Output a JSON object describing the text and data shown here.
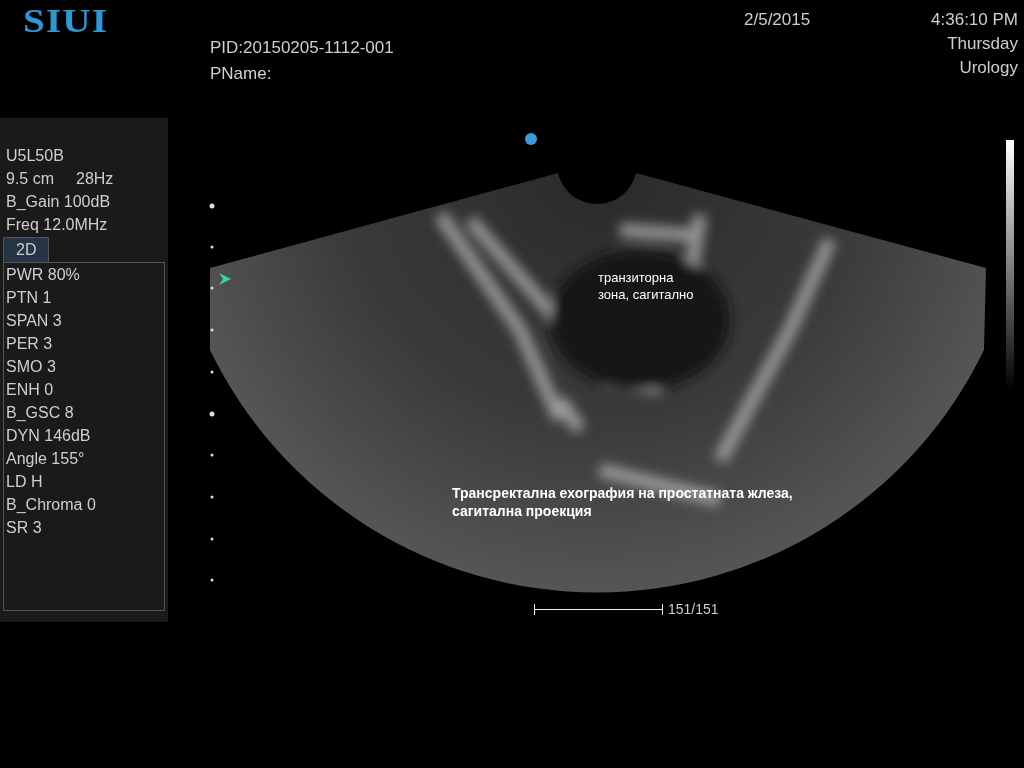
{
  "logo": "SIUI",
  "patient": {
    "pid": "PID:20150205-1112-001",
    "name": "PName:"
  },
  "date": "2/5/2015",
  "time": "4:36:10 PM",
  "weekday": "Thursday",
  "exam": "Urology",
  "probe": {
    "model": "U5L50B",
    "depth": "9.5 cm",
    "frame_rate": "28Hz",
    "gain": "B_Gain 100dB",
    "frequency": "Freq 12.0MHz"
  },
  "tabs": [
    {
      "label": "2D",
      "selected": true
    }
  ],
  "parameters": [
    "PWR 80%",
    "PTN 1",
    "SPAN 3",
    "PER 3",
    "SMO 3",
    "ENH 0",
    "B_GSC 8",
    "DYN 146dB",
    "Angle 155°",
    "LD H",
    "B_Chroma 0",
    "SR 3"
  ],
  "annotations": [
    {
      "kind": "label",
      "text": "транзиторна\nзона, сагитално"
    },
    {
      "kind": "caption",
      "text": "Трансректална ехография на простатната жлеза,\nсагитална проекция"
    }
  ],
  "cine": {
    "level": 1,
    "reading": "151/151"
  }
}
